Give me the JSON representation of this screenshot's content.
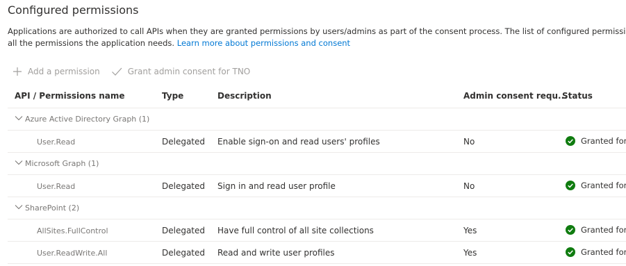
{
  "page": {
    "title": "Configured permissions",
    "description_line1": "Applications are authorized to call APIs when they are granted permissions by users/admins as part of the consent process. The list of configured permissions should include",
    "description_line2_prefix": "all the permissions the application needs. ",
    "learn_more_link": "Learn more about permissions and consent"
  },
  "toolbar": {
    "add_permission": "Add a permission",
    "grant_consent": "Grant admin consent for TNO"
  },
  "table": {
    "headers": {
      "api": "API / Permissions name",
      "type": "Type",
      "description": "Description",
      "admin_consent": "Admin consent requ...",
      "status": "Status"
    },
    "groups": [
      {
        "name": "Azure Active Directory Graph (1)",
        "permissions": [
          {
            "name": "User.Read",
            "type": "Delegated",
            "description": "Enable sign-on and read users' profiles",
            "admin_consent": "No",
            "status": "Granted for"
          }
        ]
      },
      {
        "name": "Microsoft Graph (1)",
        "permissions": [
          {
            "name": "User.Read",
            "type": "Delegated",
            "description": "Sign in and read user profile",
            "admin_consent": "No",
            "status": "Granted for"
          }
        ]
      },
      {
        "name": "SharePoint (2)",
        "permissions": [
          {
            "name": "AllSites.FullControl",
            "type": "Delegated",
            "description": "Have full control of all site collections",
            "admin_consent": "Yes",
            "status": "Granted for"
          },
          {
            "name": "User.ReadWrite.All",
            "type": "Delegated",
            "description": "Read and write user profiles",
            "admin_consent": "Yes",
            "status": "Granted for"
          }
        ]
      }
    ]
  },
  "icons": {
    "add": "plus-icon",
    "grant": "checkmark-icon",
    "expand": "chevron-down-icon",
    "granted": "granted-check-circle-icon"
  },
  "colors": {
    "link": "#0078d4",
    "granted": "#107c10",
    "disabled": "#a19f9d",
    "muted": "#797775",
    "divider": "#edebe9"
  }
}
